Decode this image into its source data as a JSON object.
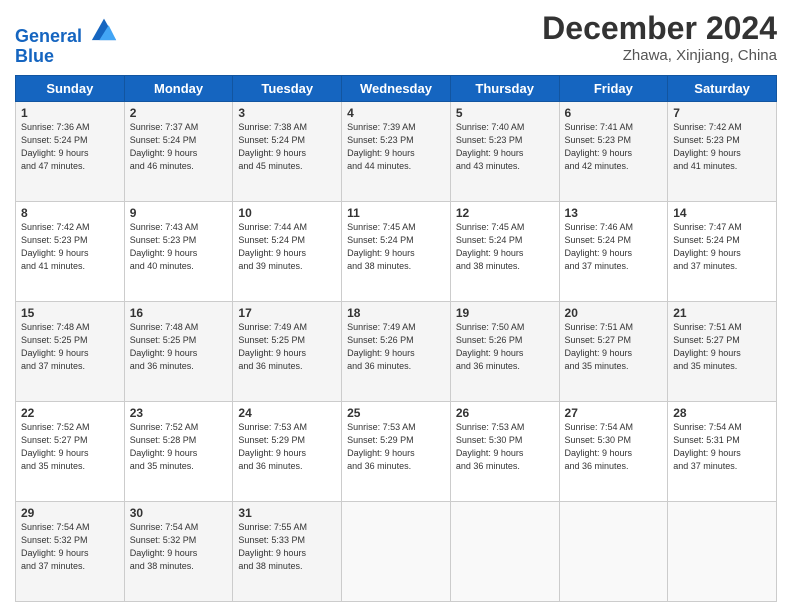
{
  "logo": {
    "line1": "General",
    "line2": "Blue"
  },
  "title": "December 2024",
  "subtitle": "Zhawa, Xinjiang, China",
  "days_header": [
    "Sunday",
    "Monday",
    "Tuesday",
    "Wednesday",
    "Thursday",
    "Friday",
    "Saturday"
  ],
  "weeks": [
    [
      {
        "day": "1",
        "info": "Sunrise: 7:36 AM\nSunset: 5:24 PM\nDaylight: 9 hours\nand 47 minutes."
      },
      {
        "day": "2",
        "info": "Sunrise: 7:37 AM\nSunset: 5:24 PM\nDaylight: 9 hours\nand 46 minutes."
      },
      {
        "day": "3",
        "info": "Sunrise: 7:38 AM\nSunset: 5:24 PM\nDaylight: 9 hours\nand 45 minutes."
      },
      {
        "day": "4",
        "info": "Sunrise: 7:39 AM\nSunset: 5:23 PM\nDaylight: 9 hours\nand 44 minutes."
      },
      {
        "day": "5",
        "info": "Sunrise: 7:40 AM\nSunset: 5:23 PM\nDaylight: 9 hours\nand 43 minutes."
      },
      {
        "day": "6",
        "info": "Sunrise: 7:41 AM\nSunset: 5:23 PM\nDaylight: 9 hours\nand 42 minutes."
      },
      {
        "day": "7",
        "info": "Sunrise: 7:42 AM\nSunset: 5:23 PM\nDaylight: 9 hours\nand 41 minutes."
      }
    ],
    [
      {
        "day": "8",
        "info": "Sunrise: 7:42 AM\nSunset: 5:23 PM\nDaylight: 9 hours\nand 41 minutes."
      },
      {
        "day": "9",
        "info": "Sunrise: 7:43 AM\nSunset: 5:23 PM\nDaylight: 9 hours\nand 40 minutes."
      },
      {
        "day": "10",
        "info": "Sunrise: 7:44 AM\nSunset: 5:24 PM\nDaylight: 9 hours\nand 39 minutes."
      },
      {
        "day": "11",
        "info": "Sunrise: 7:45 AM\nSunset: 5:24 PM\nDaylight: 9 hours\nand 38 minutes."
      },
      {
        "day": "12",
        "info": "Sunrise: 7:45 AM\nSunset: 5:24 PM\nDaylight: 9 hours\nand 38 minutes."
      },
      {
        "day": "13",
        "info": "Sunrise: 7:46 AM\nSunset: 5:24 PM\nDaylight: 9 hours\nand 37 minutes."
      },
      {
        "day": "14",
        "info": "Sunrise: 7:47 AM\nSunset: 5:24 PM\nDaylight: 9 hours\nand 37 minutes."
      }
    ],
    [
      {
        "day": "15",
        "info": "Sunrise: 7:48 AM\nSunset: 5:25 PM\nDaylight: 9 hours\nand 37 minutes."
      },
      {
        "day": "16",
        "info": "Sunrise: 7:48 AM\nSunset: 5:25 PM\nDaylight: 9 hours\nand 36 minutes."
      },
      {
        "day": "17",
        "info": "Sunrise: 7:49 AM\nSunset: 5:25 PM\nDaylight: 9 hours\nand 36 minutes."
      },
      {
        "day": "18",
        "info": "Sunrise: 7:49 AM\nSunset: 5:26 PM\nDaylight: 9 hours\nand 36 minutes."
      },
      {
        "day": "19",
        "info": "Sunrise: 7:50 AM\nSunset: 5:26 PM\nDaylight: 9 hours\nand 36 minutes."
      },
      {
        "day": "20",
        "info": "Sunrise: 7:51 AM\nSunset: 5:27 PM\nDaylight: 9 hours\nand 35 minutes."
      },
      {
        "day": "21",
        "info": "Sunrise: 7:51 AM\nSunset: 5:27 PM\nDaylight: 9 hours\nand 35 minutes."
      }
    ],
    [
      {
        "day": "22",
        "info": "Sunrise: 7:52 AM\nSunset: 5:27 PM\nDaylight: 9 hours\nand 35 minutes."
      },
      {
        "day": "23",
        "info": "Sunrise: 7:52 AM\nSunset: 5:28 PM\nDaylight: 9 hours\nand 35 minutes."
      },
      {
        "day": "24",
        "info": "Sunrise: 7:53 AM\nSunset: 5:29 PM\nDaylight: 9 hours\nand 36 minutes."
      },
      {
        "day": "25",
        "info": "Sunrise: 7:53 AM\nSunset: 5:29 PM\nDaylight: 9 hours\nand 36 minutes."
      },
      {
        "day": "26",
        "info": "Sunrise: 7:53 AM\nSunset: 5:30 PM\nDaylight: 9 hours\nand 36 minutes."
      },
      {
        "day": "27",
        "info": "Sunrise: 7:54 AM\nSunset: 5:30 PM\nDaylight: 9 hours\nand 36 minutes."
      },
      {
        "day": "28",
        "info": "Sunrise: 7:54 AM\nSunset: 5:31 PM\nDaylight: 9 hours\nand 37 minutes."
      }
    ],
    [
      {
        "day": "29",
        "info": "Sunrise: 7:54 AM\nSunset: 5:32 PM\nDaylight: 9 hours\nand 37 minutes."
      },
      {
        "day": "30",
        "info": "Sunrise: 7:54 AM\nSunset: 5:32 PM\nDaylight: 9 hours\nand 38 minutes."
      },
      {
        "day": "31",
        "info": "Sunrise: 7:55 AM\nSunset: 5:33 PM\nDaylight: 9 hours\nand 38 minutes."
      },
      null,
      null,
      null,
      null
    ]
  ]
}
